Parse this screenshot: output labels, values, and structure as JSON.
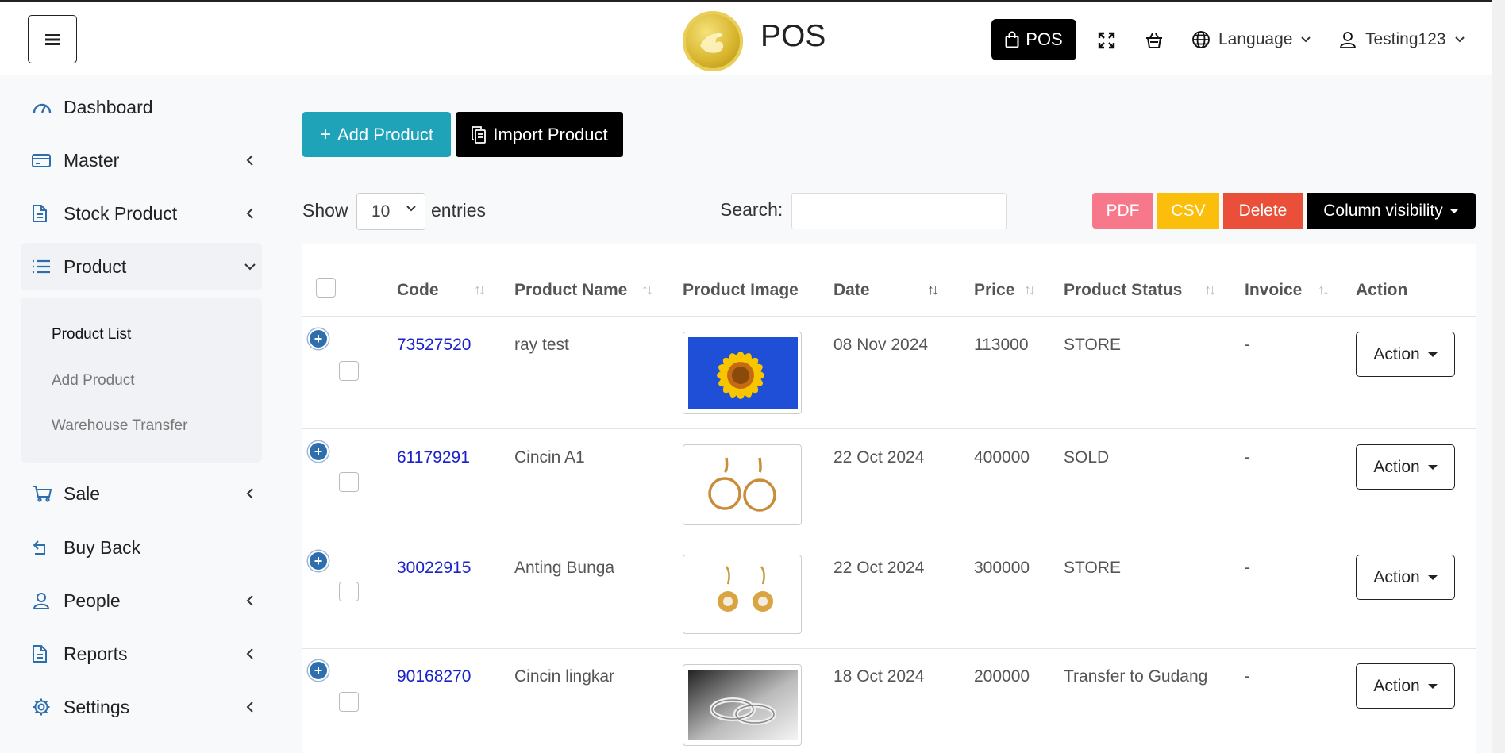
{
  "header": {
    "app_title": "POS",
    "pos_button": "POS",
    "language": "Language",
    "user": "Testing123"
  },
  "sidebar": {
    "items": [
      {
        "label": "Dashboard",
        "icon": "gauge-icon"
      },
      {
        "label": "Master",
        "icon": "card-icon"
      },
      {
        "label": "Stock Product",
        "icon": "document-icon"
      },
      {
        "label": "Product",
        "icon": "list-icon"
      },
      {
        "label": "Sale",
        "icon": "cart-icon"
      },
      {
        "label": "Buy Back",
        "icon": "return-icon"
      },
      {
        "label": "People",
        "icon": "user-icon"
      },
      {
        "label": "Reports",
        "icon": "report-icon"
      },
      {
        "label": "Settings",
        "icon": "gear-icon"
      }
    ],
    "product_submenu": [
      "Product List",
      "Add Product",
      "Warehouse Transfer"
    ]
  },
  "toolbar": {
    "add_product": "Add Product",
    "import_product": "Import Product",
    "show": "Show",
    "entries_value": "10",
    "entries": "entries",
    "search_label": "Search:",
    "search_value": "",
    "pdf": "PDF",
    "csv": "CSV",
    "delete": "Delete",
    "column_visibility": "Column visibility"
  },
  "table": {
    "columns": [
      "Code",
      "Product Name",
      "Product Image",
      "Date",
      "Price",
      "Product Status",
      "Invoice",
      "Action"
    ],
    "rows": [
      {
        "code": "73527520",
        "name": "ray test",
        "image": "sunflower",
        "date": "08 Nov 2024",
        "price": "113000",
        "status": "STORE",
        "invoice": "-",
        "action": "Action"
      },
      {
        "code": "61179291",
        "name": "Cincin A1",
        "image": "hoop-earrings",
        "date": "22 Oct 2024",
        "price": "400000",
        "status": "SOLD",
        "invoice": "-",
        "action": "Action"
      },
      {
        "code": "30022915",
        "name": "Anting Bunga",
        "image": "flower-earrings",
        "date": "22 Oct 2024",
        "price": "300000",
        "status": "STORE",
        "invoice": "-",
        "action": "Action"
      },
      {
        "code": "90168270",
        "name": "Cincin lingkar",
        "image": "rings",
        "date": "18 Oct 2024",
        "price": "200000",
        "status": "Transfer to Gudang",
        "invoice": "-",
        "action": "Action"
      }
    ]
  },
  "colors": {
    "add_button": "#1fa3b8",
    "pdf": "#f7788a",
    "csv": "#fbbf0b",
    "delete": "#ea5039",
    "code_link": "#1b22c9",
    "expand_button": "#2f6ead"
  }
}
